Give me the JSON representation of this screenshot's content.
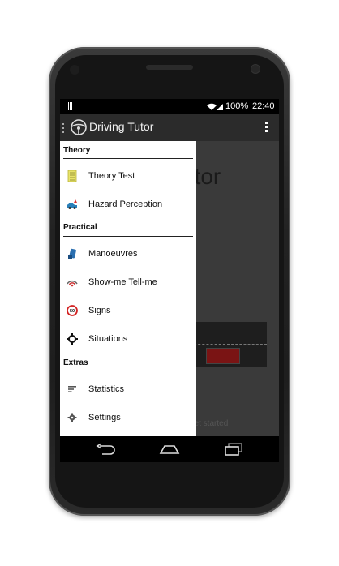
{
  "status_bar": {
    "battery": "100%",
    "time": "22:40"
  },
  "action_bar": {
    "title": "Driving Tutor"
  },
  "content": {
    "title_fragment": "utor",
    "hint_fragment": "get started"
  },
  "drawer": {
    "sections": [
      {
        "title": "Theory",
        "items": [
          {
            "label": "Theory Test",
            "icon": "document-icon"
          },
          {
            "label": "Hazard Perception",
            "icon": "car-hazard-icon"
          }
        ]
      },
      {
        "title": "Practical",
        "items": [
          {
            "label": "Manoeuvres",
            "icon": "manoeuvre-icon"
          },
          {
            "label": "Show-me Tell-me",
            "icon": "signal-arc-icon"
          },
          {
            "label": "Signs",
            "icon": "speed-sign-icon"
          },
          {
            "label": "Situations",
            "icon": "crosshair-icon"
          }
        ]
      },
      {
        "title": "Extras",
        "items": [
          {
            "label": "Statistics",
            "icon": "statistics-icon"
          },
          {
            "label": "Settings",
            "icon": "gear-icon"
          }
        ]
      }
    ]
  },
  "speed_sign_value": "50",
  "colors": {
    "action_bar": "#2b2b2b",
    "drawer_bg": "#ffffff",
    "sign_red": "#d32222",
    "car_red": "#7a1414"
  }
}
